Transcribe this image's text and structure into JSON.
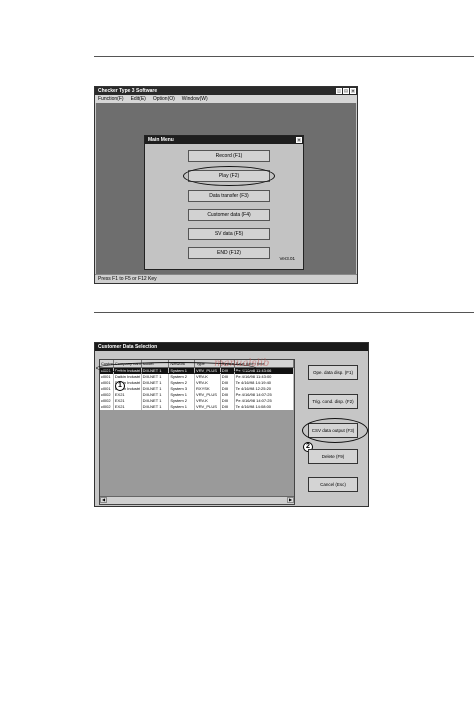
{
  "top_window": {
    "title": "Checker Type 3 Software",
    "menu": [
      "Function(F)",
      "Edit(E)",
      "Option(O)",
      "Window(W)"
    ],
    "status": "Press F1 to F5 or F12 Key",
    "main_menu": {
      "title": "Main Menu",
      "buttons": [
        "Record (F1)",
        "Play (F2)",
        "Data transfer (F3)",
        "Customer data (F4)",
        "SV data (F5)",
        "END (F12)"
      ],
      "version": "Ver3.01"
    }
  },
  "bottom_window": {
    "title": "Customer Data Selection",
    "columns": [
      "Customer",
      "Company name",
      "Model",
      "Network",
      "Type",
      "System",
      "Save date / time"
    ],
    "rows": [
      [
        "cl001",
        "Daikin Industri",
        "DIII-NET 1",
        "System 1",
        "VRV_PLUS",
        "DIII",
        "Pe 4/16/98 11:43:06"
      ],
      [
        "cl001",
        "Daikin Industri",
        "DIII-NET 1",
        "System 2",
        "VRV-K",
        "DIII",
        "Pe 4/16/98 11:43:00"
      ],
      [
        "cl001",
        "Daikin Industri",
        "DIII-NET 1",
        "System 2",
        "VRV-K",
        "DIII",
        "Te 4/16/98 14:19:40"
      ],
      [
        "cl001",
        "Daikin Industri",
        "DIII-NET 1",
        "System 3",
        "RXYSK",
        "DIII",
        "Te 4/16/98 12:25:20"
      ],
      [
        "cl002",
        "EX21",
        "DIII-NET 1",
        "System 1",
        "VRV_PLUS",
        "DIII",
        "Pe 4/16/98 14:07:25"
      ],
      [
        "cl002",
        "EX21",
        "DIII-NET 1",
        "System 2",
        "VRV-K",
        "DIII",
        "Pe 4/16/98 14:07:25"
      ],
      [
        "cl002",
        "EX21",
        "DIII-NET 1",
        "System 1",
        "VRV_PLUS",
        "DIII",
        "Te 4/16/98 14:08:00"
      ]
    ],
    "buttons": [
      "Ope. data disp. (F1)",
      "Trig. cond. disp. (F2)",
      "CSV data output (F3)",
      "Delete (F9)",
      "Cancel (Esc)"
    ],
    "callouts": [
      "1",
      "2"
    ],
    "watermark": "manualslib"
  }
}
